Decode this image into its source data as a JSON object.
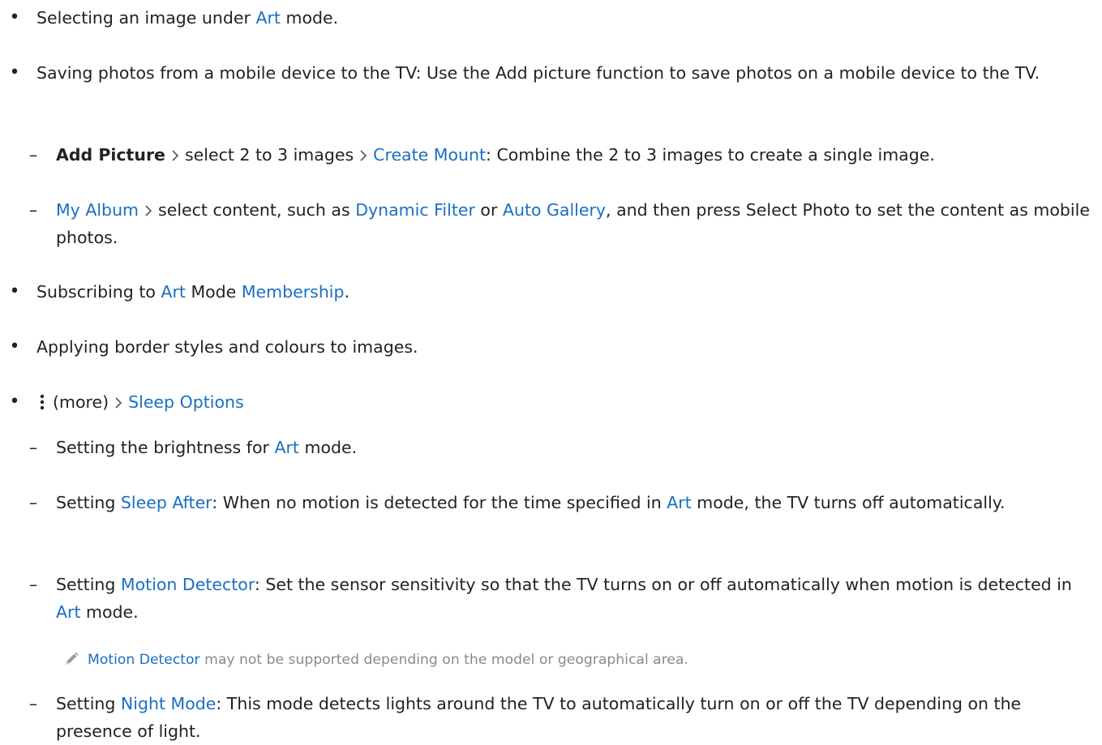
{
  "items": {
    "i1": {
      "a": "Selecting an image under ",
      "b": "Art",
      "c": " mode."
    },
    "i2": {
      "text": "Saving photos from a mobile device to the TV: Use the Add picture function to save photos on a mobile device to the TV."
    },
    "i2a": {
      "a": "Add Picture",
      "b": "select 2 to 3 images",
      "c": "Create Mount",
      "d": ": Combine the 2 to 3 images to create a single image."
    },
    "i2b": {
      "a": "My Album",
      "b": "select content, such as ",
      "c": "Dynamic Filter",
      "d": " or ",
      "e": "Auto Gallery",
      "f": ", and then press Select Photo to set the content as mobile photos."
    },
    "i3": {
      "a": "Subscribing to ",
      "b": "Art",
      "c": " Mode ",
      "d": "Membership",
      "e": "."
    },
    "i4": {
      "text": "Applying border styles and colours to images."
    },
    "i5": {
      "a": "(more)",
      "b": "Sleep Options"
    },
    "i5a": {
      "a": "Setting the brightness for ",
      "b": "Art",
      "c": " mode."
    },
    "i5b": {
      "a": "Setting ",
      "b": "Sleep After",
      "c": ": When no motion is detected for the time specified in ",
      "d": "Art",
      "e": " mode, the TV turns off automatically."
    },
    "i5c": {
      "a": "Setting ",
      "b": "Motion Detector",
      "c": ": Set the sensor sensitivity so that the TV turns on or off automatically when motion is detected in ",
      "d": "Art",
      "e": " mode."
    },
    "note": {
      "a": "Motion Detector",
      "b": " may not be supported depending on the model or geographical area."
    },
    "i5d": {
      "a": "Setting ",
      "b": "Night Mode",
      "c": ": This mode detects lights around the TV to automatically turn on or off the TV depending on the presence of light."
    }
  },
  "symbols": {
    "bullet": "•",
    "dash": "–"
  },
  "colors": {
    "link": "#1a6fc2",
    "text": "#222222",
    "note": "#8a8a8a"
  },
  "icons": {
    "chevron": "chevron-right-icon",
    "more": "more-vertical-icon",
    "note": "pencil-note-icon"
  }
}
